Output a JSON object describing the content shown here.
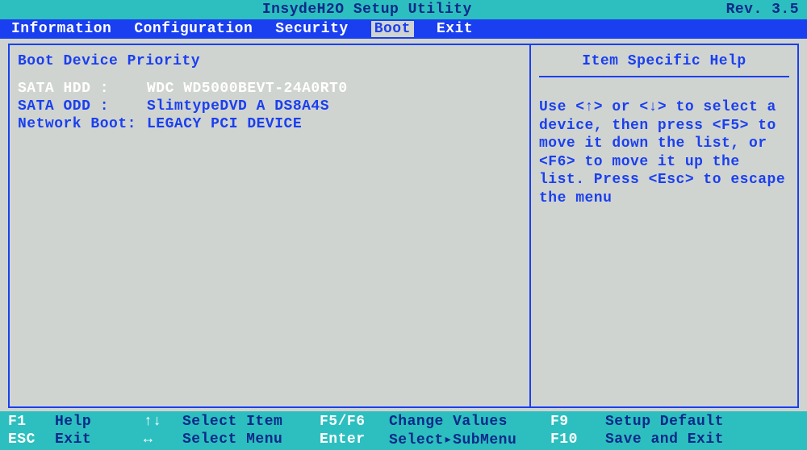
{
  "header": {
    "title": "InsydeH2O Setup Utility",
    "revision": "Rev. 3.5"
  },
  "menu": {
    "tabs": [
      {
        "label": "Information",
        "active": false
      },
      {
        "label": "Configuration",
        "active": false
      },
      {
        "label": "Security",
        "active": false
      },
      {
        "label": "Boot",
        "active": true
      },
      {
        "label": "Exit",
        "active": false
      }
    ]
  },
  "left": {
    "title": "Boot Device Priority",
    "items": [
      {
        "label": "SATA HDD    :",
        "value": " WDC WD5000BEVT-24A0RT0",
        "selected": true
      },
      {
        "label": "SATA ODD    :",
        "value": " SlimtypeDVD A DS8A4S",
        "selected": false
      },
      {
        "label": "Network Boot:",
        "value": " LEGACY PCI DEVICE",
        "selected": false
      }
    ]
  },
  "right": {
    "title": "Item Specific Help",
    "text": "Use <↑> or <↓> to select a device, then press <F5> to move it down the list, or <F6> to move it up the list. Press <Esc> to escape the menu"
  },
  "footer": {
    "rows": [
      [
        {
          "key": "F1",
          "label": "Help"
        },
        {
          "key": "↑↓",
          "label": "Select Item"
        },
        {
          "key": "F5/F6",
          "label": "Change Values"
        },
        {
          "key": "F9",
          "label": "Setup Default"
        }
      ],
      [
        {
          "key": "ESC",
          "label": "Exit"
        },
        {
          "key": "↔",
          "label": "Select Menu"
        },
        {
          "key": "Enter",
          "label": "Select▸SubMenu"
        },
        {
          "key": "F10",
          "label": "Save and Exit"
        }
      ]
    ]
  }
}
